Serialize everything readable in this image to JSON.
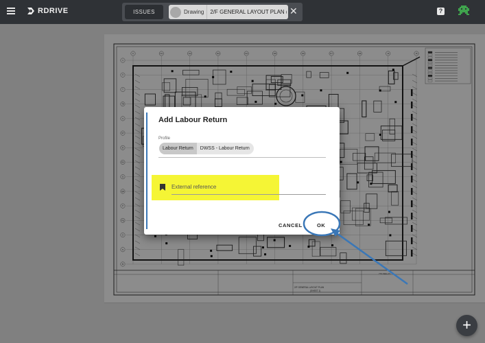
{
  "app": {
    "brand": "RDRIVE"
  },
  "tabs": {
    "issues_label": "ISSUES",
    "drawing_label": "Drawing",
    "drawing_title": "2/F GENERAL LAYOUT PLAN (S"
  },
  "dialog": {
    "title": "Add Labour Return",
    "profile_label": "Profile",
    "profile_chips": [
      "Labour Return",
      "DWSS - Labour Return"
    ],
    "external_reference_placeholder": "External reference",
    "cancel_label": "CANCEL",
    "ok_label": "OK"
  },
  "drawing": {
    "grid_top": [
      "K",
      "N1",
      "N2",
      "N3",
      "N4",
      "N5",
      "N6",
      "N7",
      "N8",
      "J4",
      "J5"
    ],
    "grid_left": [
      "V",
      "U",
      "T",
      "TB",
      "S",
      "ST",
      "R",
      "RS",
      "Q",
      "QR",
      "P",
      "PQ",
      "O",
      "N",
      "M"
    ],
    "title_block": {
      "drawing_title": "2/F GENERAL LAYOUT PLAN",
      "sheet": "(SHEET 1)",
      "drawing_no": "770-SEE-2/1"
    }
  },
  "icons": {
    "menu": "menu-icon",
    "help": "help-icon",
    "close": "close-icon",
    "bookmark": "bookmark-icon",
    "add": "add-icon"
  },
  "colors": {
    "topbar": "#2f3236",
    "highlight": "#f5f535",
    "annotation": "#3a77b7",
    "avatar": "#3fa34d"
  }
}
